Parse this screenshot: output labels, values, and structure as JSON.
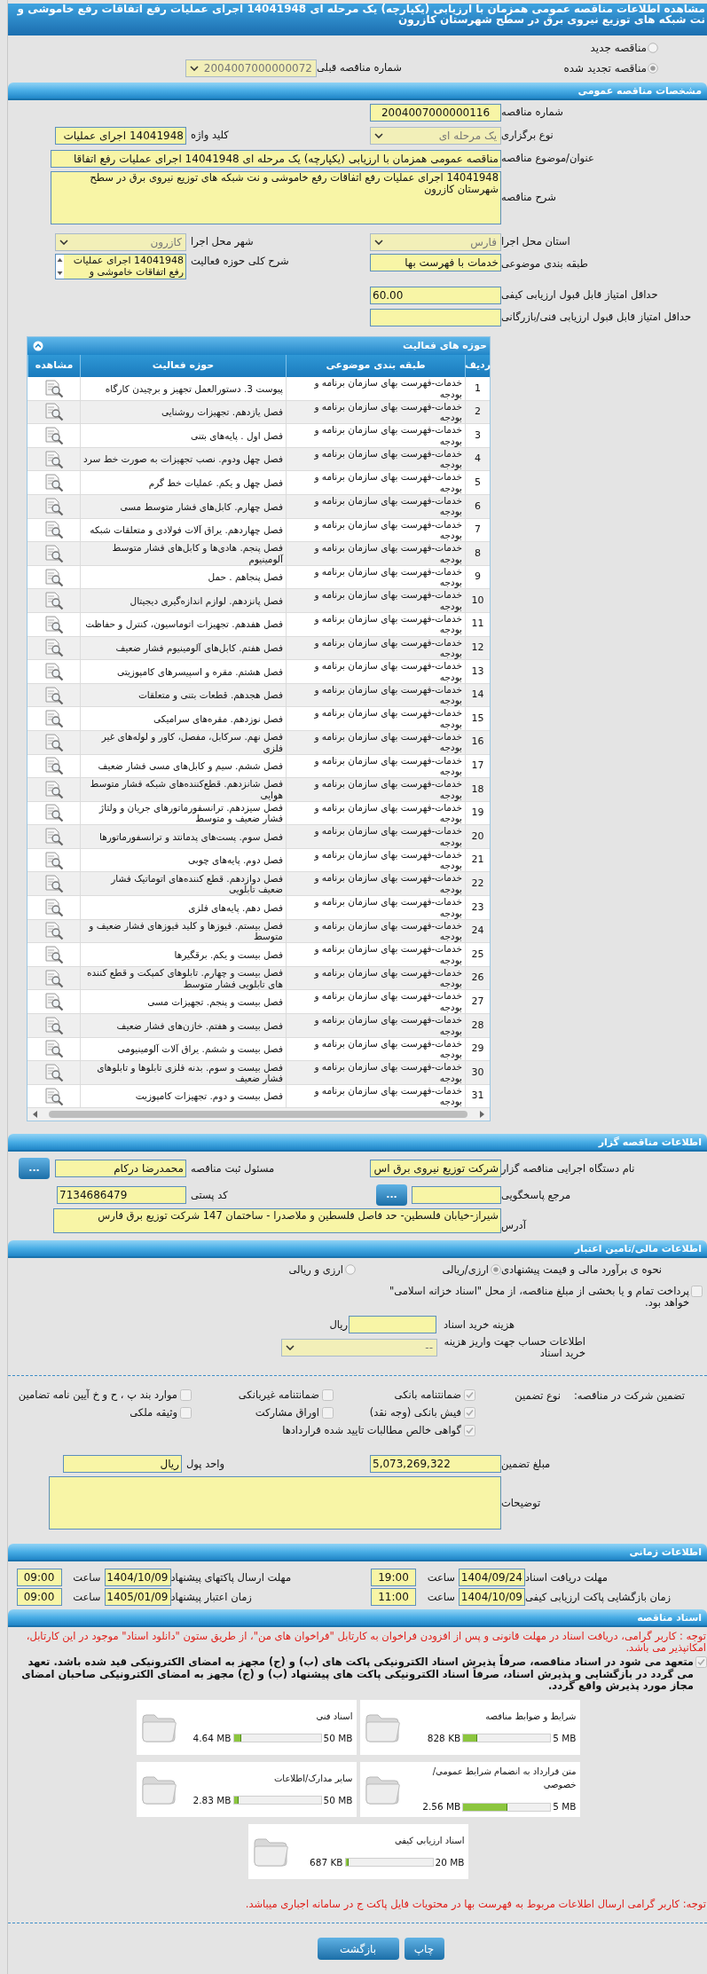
{
  "title": "مشاهده اطلاعات مناقصه عمومی همزمان با ارزیابی (یکپارچه) یک مرحله ای 14041948 اجرای عملیات رفع اتفاقات رفع خاموشی و نت شبکه های توزیع نیروی برق در سطح شهرستان کازرون",
  "tender_kind": {
    "options": [
      {
        "label": "مناقصه جدید",
        "selected": false
      },
      {
        "label": "مناقصه تجدید شده",
        "selected": true
      }
    ],
    "previous_number": {
      "label": "شماره مناقصه قبلی",
      "value": "2004007000000072"
    }
  },
  "general": {
    "header": "مشخصات مناقصه عمومی",
    "tender_number": {
      "label": "شماره مناقصه",
      "value": "2004007000000116"
    },
    "holding_type": {
      "label": "نوع برگزاری",
      "value": "یک مرحله ای"
    },
    "keyword": {
      "label": "کلید واژه",
      "value": "14041948 اجرای عملیات"
    },
    "subject": {
      "label": "عنوان/موضوع مناقصه",
      "value": "مناقصه عمومی همزمان با ارزیابی (یکپارچه) یک مرحله ای 14041948 اجرای عملیات رفع اتفاقا"
    },
    "description": {
      "label": "شرح مناقصه",
      "value": "14041948 اجرای عملیات رفع اتفاقات رفع خاموشی و نت شبکه های توزیع نیروی برق در سطح شهرستان کازرون"
    },
    "province": {
      "label": "استان محل اجرا",
      "value": "فارس"
    },
    "city": {
      "label": "شهر محل اجرا",
      "value": "کازرون"
    },
    "category": {
      "label": "طبقه بندی موضوعی",
      "value": "خدمات با فهرست بها"
    },
    "activity_scope": {
      "label": "شرح کلی حوزه فعالیت",
      "value": "14041948 اجرای عملیات رفع اتفاقات خاموشی و"
    },
    "min_quality": {
      "label": "حداقل امتیاز قابل قبول ارزیابی کیفی",
      "value": "60.00"
    },
    "min_technical": {
      "label": "حداقل امتیاز قابل قبول ارزیابی فنی/بازرگانی"
    }
  },
  "activities": {
    "header": "حوزه های فعالیت",
    "columns": [
      "ردیف",
      "طبقه بندی موضوعی",
      "حوزه فعالیت",
      "مشاهده"
    ],
    "rows": [
      {
        "number": "1",
        "category": "خدمات-فهرست بهای سازمان برنامه و بودجه",
        "activity": "پیوست 3. دستورالعمل تجهیز و برچیدن کارگاه"
      },
      {
        "number": "2",
        "category": "خدمات-فهرست بهای سازمان برنامه و بودجه",
        "activity": "فصل یازدهم. تجهیزات روشنایی"
      },
      {
        "number": "3",
        "category": "خدمات-فهرست بهای سازمان برنامه و بودجه",
        "activity": "فصل اول . پایه‌های بتنی"
      },
      {
        "number": "4",
        "category": "خدمات-فهرست بهای سازمان برنامه و بودجه",
        "activity": "فصل چهل ودوم. نصب تجهیزات به صورت خط سرد"
      },
      {
        "number": "5",
        "category": "خدمات-فهرست بهای سازمان برنامه و بودجه",
        "activity": "فصل چهل و یکم. عملیات خط گرم"
      },
      {
        "number": "6",
        "category": "خدمات-فهرست بهای سازمان برنامه و بودجه",
        "activity": "فصل چهارم. کابل‌های فشار متوسط مسی"
      },
      {
        "number": "7",
        "category": "خدمات-فهرست بهای سازمان برنامه و بودجه",
        "activity": "فصل چهاردهم. یراق آلات فولادی و متعلقات شبکه"
      },
      {
        "number": "8",
        "category": "خدمات-فهرست بهای سازمان برنامه و بودجه",
        "activity": "فصل پنجم. هادی‌ها و کابل‌های فشار متوسط آلومینیوم"
      },
      {
        "number": "9",
        "category": "خدمات-فهرست بهای سازمان برنامه و بودجه",
        "activity": "فصل پنجاهم . حمل"
      },
      {
        "number": "10",
        "category": "خدمات-فهرست بهای سازمان برنامه و بودجه",
        "activity": "فصل پانزدهم. لوازم اندازه‌گیری دیجیتال"
      },
      {
        "number": "11",
        "category": "خدمات-فهرست بهای سازمان برنامه و بودجه",
        "activity": "فصل هفدهم. تجهیزات اتوماسیون، کنترل و حفاظت"
      },
      {
        "number": "12",
        "category": "خدمات-فهرست بهای سازمان برنامه و بودجه",
        "activity": "فصل هفتم. کابل‌های آلومینیوم فشار ضعیف"
      },
      {
        "number": "13",
        "category": "خدمات-فهرست بهای سازمان برنامه و بودجه",
        "activity": "فصل هشتم. مقره و اسپیسرهای کامپوزیتی"
      },
      {
        "number": "14",
        "category": "خدمات-فهرست بهای سازمان برنامه و بودجه",
        "activity": "فصل هجدهم. قطعات بتنی و متعلقات"
      },
      {
        "number": "15",
        "category": "خدمات-فهرست بهای سازمان برنامه و بودجه",
        "activity": "فصل نوزدهم. مقره‌های سرامیکی"
      },
      {
        "number": "16",
        "category": "خدمات-فهرست بهای سازمان برنامه و بودجه",
        "activity": "فصل نهم. سرکابل، مفصل، کاور و لوله‌های غیر فلزی"
      },
      {
        "number": "17",
        "category": "خدمات-فهرست بهای سازمان برنامه و بودجه",
        "activity": "فصل ششم. سیم و کابل‌های مسی فشار ضعیف"
      },
      {
        "number": "18",
        "category": "خدمات-فهرست بهای سازمان برنامه و بودجه",
        "activity": "فصل شانزدهم. قطع‌کننده‌های شبکه فشار متوسط هوایی"
      },
      {
        "number": "19",
        "category": "خدمات-فهرست بهای سازمان برنامه و بودجه",
        "activity": "فصل سیزدهم. ترانسفورماتورهای جریان و ولتاژ فشار ضعیف و متوسط"
      },
      {
        "number": "20",
        "category": "خدمات-فهرست بهای سازمان برنامه و بودجه",
        "activity": "فصل سوم. پست‌های پدمانتد و ترانسفورماتورها"
      },
      {
        "number": "21",
        "category": "خدمات-فهرست بهای سازمان برنامه و بودجه",
        "activity": "فصل دوم. پایه‌های چوبی"
      },
      {
        "number": "22",
        "category": "خدمات-فهرست بهای سازمان برنامه و بودجه",
        "activity": "فصل دوازدهم. قطع کننده‌های اتوماتیک فشار ضعیف تابلویی"
      },
      {
        "number": "23",
        "category": "خدمات-فهرست بهای سازمان برنامه و بودجه",
        "activity": "فصل دهم. پایه‌های فلزی"
      },
      {
        "number": "24",
        "category": "خدمات-فهرست بهای سازمان برنامه و بودجه",
        "activity": "فصل بیستم. فیوزها و کلید فیوزهای فشار ضعیف و متوسط"
      },
      {
        "number": "25",
        "category": "خدمات-فهرست بهای سازمان برنامه و بودجه",
        "activity": "فصل بیست و یکم. برقگیرها"
      },
      {
        "number": "26",
        "category": "خدمات-فهرست بهای سازمان برنامه و بودجه",
        "activity": "فصل بیست و چهارم. تابلوهای کمپکت و قطع کننده های تابلویی فشار متوسط"
      },
      {
        "number": "27",
        "category": "خدمات-فهرست بهای سازمان برنامه و بودجه",
        "activity": "فصل بیست و پنجم. تجهیزات مسی"
      },
      {
        "number": "28",
        "category": "خدمات-فهرست بهای سازمان برنامه و بودجه",
        "activity": "فصل بیست و هفتم. خازن‌های فشار ضعیف"
      },
      {
        "number": "29",
        "category": "خدمات-فهرست بهای سازمان برنامه و بودجه",
        "activity": "فصل بیست و ششم. یراق آلات آلومینیومی"
      },
      {
        "number": "30",
        "category": "خدمات-فهرست بهای سازمان برنامه و بودجه",
        "activity": "فصل بیست و سوم. بدنه فلزی تابلوها و تابلوهای فشار ضعیف"
      },
      {
        "number": "31",
        "category": "خدمات-فهرست بهای سازمان برنامه و بودجه",
        "activity": "فصل بیست و دوم. تجهیزات کامپوزیت"
      }
    ]
  },
  "organizer": {
    "header": "اطلاعات مناقصه گزار",
    "org_name": {
      "label": "نام دستگاه اجرایی مناقصه گزار",
      "value": "شرکت توزیع نیروی برق اس"
    },
    "registrar": {
      "label": "مسئول ثبت مناقصه",
      "value": "محمدرضا درکام",
      "button": "..."
    },
    "responder": {
      "label": "مرجع پاسخگویی",
      "button": "..."
    },
    "postal_code": {
      "label": "کد پستی",
      "value": "7134686479"
    },
    "address": {
      "label": "آدرس",
      "value": "شیراز-خیابان فلسطین-  حد فاصل فلسطین و ملاصدرا - ساختمان 147 شرکت توزیع برق فارس"
    }
  },
  "finance": {
    "header": "اطلاعات مالی/تامین اعتبار",
    "estimate": {
      "label": "نحوه ی برآورد مالی و قیمت پیشنهادی",
      "options": [
        {
          "label": "ارزی/ریالی",
          "selected": true
        },
        {
          "label": "ارزی و ریالی",
          "selected": false
        }
      ]
    },
    "treasury": {
      "label": "پرداخت تمام و یا بخشی از مبلغ مناقصه، از محل \"اسناد خزانه اسلامی\" خواهد بود.",
      "checked": false
    },
    "doc_cost": {
      "label": "هزینه خرید اسناد",
      "unit": "ریال"
    },
    "account": {
      "label": "اطلاعات حساب جهت واریز هزینه خرید اسناد",
      "value": "--"
    },
    "guarantee": {
      "label": "تضمین شرکت در مناقصه:",
      "type_label": "نوع تضمین",
      "options": [
        {
          "label": "ضمانتنامه بانکی",
          "checked": true
        },
        {
          "label": "ضمانتنامه غیربانکی",
          "checked": false
        },
        {
          "label": "موارد بند پ ، ح و خ آیین نامه تضامین",
          "checked": false
        },
        {
          "label": "فیش بانکی (وجه نقد)",
          "checked": true
        },
        {
          "label": "اوراق مشارکت",
          "checked": false
        },
        {
          "label": "وثیقه ملکی",
          "checked": false
        },
        {
          "label": "گواهی خالص مطالبات تایید شده قراردادها",
          "checked": true
        }
      ]
    },
    "amount": {
      "label": "مبلغ تضمین",
      "value": "5,073,269,322"
    },
    "currency": {
      "label": "واحد پول",
      "value": "ریال"
    },
    "notes": {
      "label": "توضیحات"
    }
  },
  "timing": {
    "header": "اطلاعات زمانی",
    "rows": [
      {
        "label": "مهلت دریافت اسناد",
        "date": "1404/09/24",
        "time_label": "ساعت",
        "time": "19:00"
      },
      {
        "label": "مهلت ارسال پاکتهای پیشنهاد",
        "date": "1404/10/09",
        "time_label": "ساعت",
        "time": "09:00"
      },
      {
        "label": "زمان بازگشایی پاکت ارزیابی کیفی",
        "date": "1404/10/09",
        "time_label": "ساعت",
        "time": "11:00"
      },
      {
        "label": "زمان اعتبار پیشنهاد",
        "date": "1405/01/09",
        "time_label": "ساعت",
        "time": "09:00"
      }
    ]
  },
  "documents": {
    "header": "اسناد مناقصه",
    "notice": "توجه : کاربر گرامی، دریافت اسناد در مهلت قانونی و پس از افزودن فراخوان به کارتابل \"فراخوان های من\"، از طریق ستون \"دانلود اسناد\" موجود در این کارتابل، امکانپذیر می باشد.",
    "commitment": {
      "text": "متعهد می شود در اسناد مناقصه، صرفاً پذیرش اسناد الکترونیکی پاکت های (ب) و (ج) مجهز به امضای الکترونیکی قید شده باشد. تعهد می گردد در بازگشایی و پذیرش اسناد، صرفاً اسناد الکترونیکی پاکت های پیشنهاد (ب) و (ج) مجهز به امضای الکترونیکی صاحبان امضای مجاز مورد پذیرش واقع گردد.",
      "checked": true
    },
    "files": [
      {
        "name": "شرایط و ضوابط مناقصه",
        "size": "828 KB",
        "max": "5 MB",
        "level": 0.16
      },
      {
        "name": "اسناد فنی",
        "size": "4.64 MB",
        "max": "50 MB",
        "level": 0.09
      },
      {
        "name": "متن قرارداد به انضمام شرایط عمومی/خصوصی",
        "size": "2.56 MB",
        "max": "5 MB",
        "level": 0.51
      },
      {
        "name": "سایر مدارک/اطلاعات",
        "size": "2.83 MB",
        "max": "50 MB",
        "level": 0.06
      },
      {
        "name": "اسناد ارزیابی کیفی",
        "size": "687 KB",
        "max": "20 MB",
        "level": 0.04
      }
    ],
    "footer_note": "توجه: کاربر گرامی ارسال اطلاعات مربوط به فهرست بها در محتویات فایل پاکت ج در سامانه اجباری میباشد."
  },
  "buttons": [
    "چاپ",
    "بازگشت"
  ]
}
